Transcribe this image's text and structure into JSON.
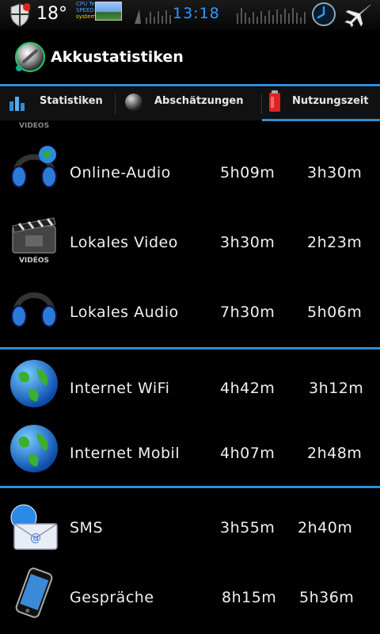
{
  "status_bar": {
    "temperature": "18°",
    "cpu_lines": [
      "CPU Temp",
      "SPEED",
      "system-sensor"
    ],
    "time": "13:18",
    "icons": [
      "shield-icon",
      "clock-icon",
      "airplane-icon"
    ]
  },
  "header": {
    "title": "Akkustatistiken",
    "icon": "battery-disc-icon"
  },
  "tabs": [
    {
      "label": "Statistiken",
      "icon": "bar-chart-icon",
      "active": false
    },
    {
      "label": "Abschätzungen",
      "icon": "sphere-icon",
      "active": false
    },
    {
      "label": "Nutzungszeit",
      "icon": "battery-can-icon",
      "active": true
    }
  ],
  "list": {
    "partial_label": "VIDEOS",
    "rows": [
      {
        "label": "Online-Audio",
        "v1": "5h09m",
        "v2": "3h30m",
        "icon": "headphones-globe-icon"
      },
      {
        "label": "Lokales Video",
        "v1": "3h30m",
        "v2": "2h23m",
        "icon": "film-clapper-icon",
        "sub": "VIDÉOS"
      },
      {
        "label": "Lokales Audio",
        "v1": "7h30m",
        "v2": "5h06m",
        "icon": "headphones-icon"
      },
      {
        "label": "Internet WiFi",
        "v1": "4h42m",
        "v2": "3h12m",
        "icon": "globe-icon"
      },
      {
        "label": "Internet Mobil",
        "v1": "4h07m",
        "v2": "2h48m",
        "icon": "globe-icon"
      },
      {
        "label": "SMS",
        "v1": "3h55m",
        "v2": "2h40m",
        "icon": "email-envelope-icon"
      },
      {
        "label": "Gespräche",
        "v1": "8h15m",
        "v2": "5h36m",
        "icon": "phone-icon"
      }
    ]
  },
  "colors": {
    "accent": "#2d8fd8",
    "time": "#2a9cff",
    "background": "#000000"
  }
}
